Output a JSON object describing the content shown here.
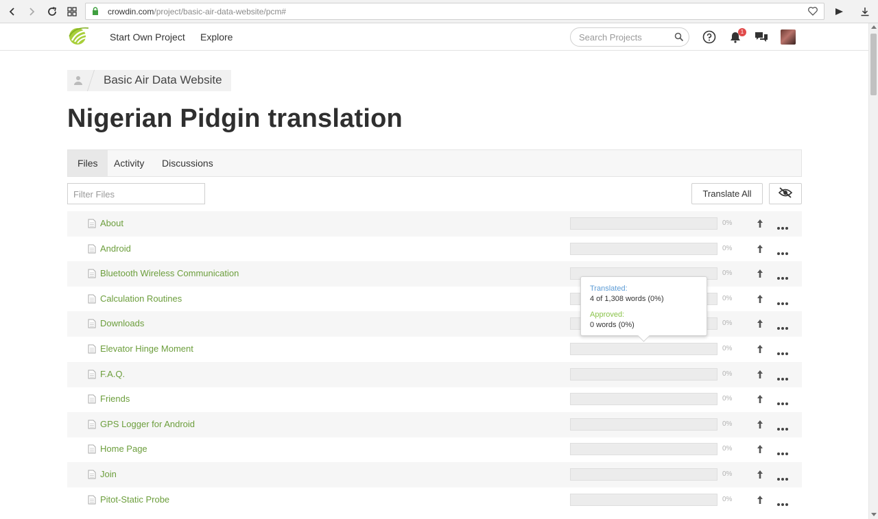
{
  "browser": {
    "url_host": "crowdin.com",
    "url_path": "/project/basic-air-data-website/pcm#"
  },
  "header": {
    "nav": [
      "Start Own Project",
      "Explore"
    ],
    "search_placeholder": "Search Projects",
    "notification_count": "1"
  },
  "breadcrumb": {
    "project": "Basic Air Data Website"
  },
  "page_title": "Nigerian Pidgin translation",
  "tabs": [
    "Files",
    "Activity",
    "Discussions"
  ],
  "active_tab": "Files",
  "filter": {
    "placeholder": "Filter Files"
  },
  "actions": {
    "translate_all": "Translate All"
  },
  "files": [
    {
      "name": "About",
      "progress": 0,
      "pct": "0%"
    },
    {
      "name": "Android",
      "progress": 0,
      "pct": "0%"
    },
    {
      "name": "Bluetooth Wireless Communication",
      "progress": 0,
      "pct": "0%"
    },
    {
      "name": "Calculation Routines",
      "progress": 0,
      "pct": "0%"
    },
    {
      "name": "Downloads",
      "progress": 0,
      "pct": "0%"
    },
    {
      "name": "Elevator Hinge Moment",
      "progress": 0,
      "pct": "0%"
    },
    {
      "name": "F.A.Q.",
      "progress": 0,
      "pct": "0%"
    },
    {
      "name": "Friends",
      "progress": 0,
      "pct": "0%"
    },
    {
      "name": "GPS Logger for Android",
      "progress": 0,
      "pct": "0%"
    },
    {
      "name": "Home Page",
      "progress": 0,
      "pct": "0%"
    },
    {
      "name": "Join",
      "progress": 0,
      "pct": "0%"
    },
    {
      "name": "Pitot-Static Probe",
      "progress": 0,
      "pct": "0%"
    }
  ],
  "tooltip": {
    "translated_label": "Translated:",
    "translated_value": "4 of 1,308 words (0%)",
    "approved_label": "Approved:",
    "approved_value": "0 words (0%)"
  },
  "colors": {
    "link_green": "#6c9e3c",
    "progress_green": "#8ac34a",
    "translated_blue": "#5b9bd5",
    "badge_red": "#e14b4b"
  }
}
